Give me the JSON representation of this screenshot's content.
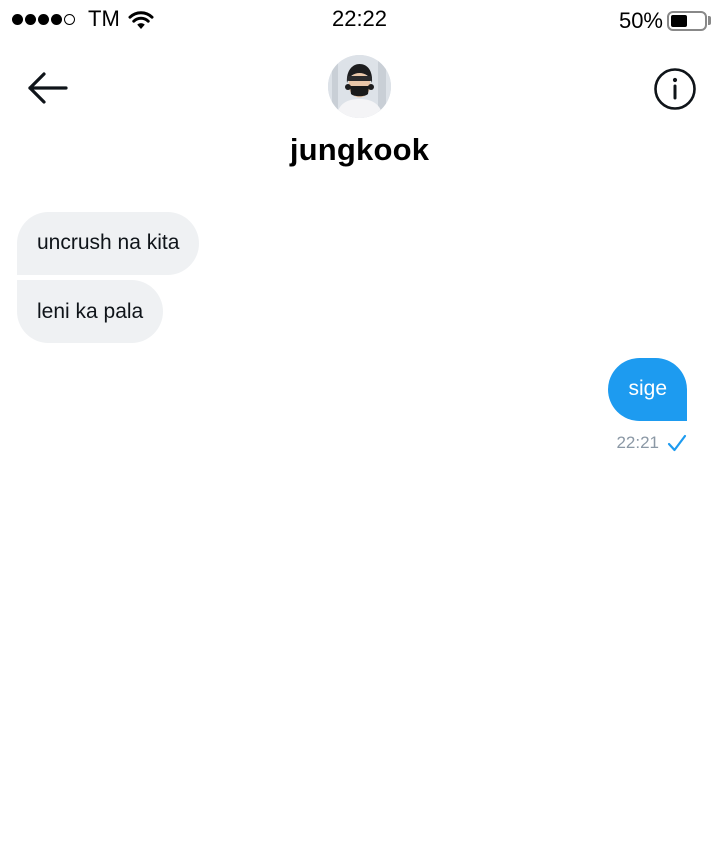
{
  "status_bar": {
    "carrier": "TM",
    "time": "22:22",
    "battery_percent": "50%",
    "battery_level": 0.5,
    "signal_bars_filled": 4,
    "signal_bars_total": 5,
    "icons": [
      "wifi-icon",
      "battery-icon"
    ]
  },
  "header": {
    "back_icon": "arrow-left-icon",
    "info_icon": "info-icon",
    "profile_name": "jungkook"
  },
  "messages": [
    {
      "direction": "incoming",
      "text": "uncrush na kita"
    },
    {
      "direction": "incoming",
      "text": "leni ka pala"
    },
    {
      "direction": "outgoing",
      "text": "sige",
      "time": "22:21",
      "status_icon": "checkmark-icon"
    }
  ],
  "colors": {
    "outgoing_bubble": "#1d9bf0",
    "incoming_bubble": "#eff1f3",
    "timestamp": "#8b98a5"
  }
}
